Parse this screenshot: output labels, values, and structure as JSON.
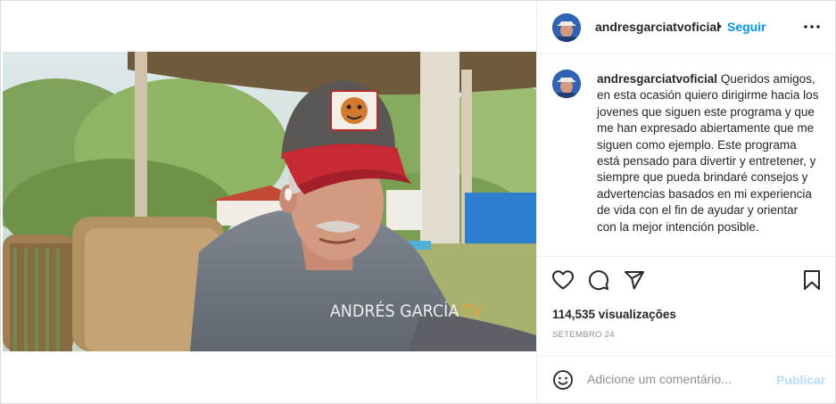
{
  "post": {
    "username": "andresgarciatvoficial",
    "separator": "•",
    "follow_label": "Seguir",
    "more_icon": "more-options-icon",
    "caption_text": "Queridos amigos, en esta ocasión quiero dirigirme hacia los jovenes que siguen este programa y que me han expresado abiertamente que me siguen como ejemplo. Este programa está pensado para divertir y entretener, y siempre que pueda brindaré consejos y advertencias basados en mi experiencia de vida con el fin de ayudar y orientar con la mejor intención posible.",
    "views": "114,535 visualizações",
    "date": "SETEMBRO 24"
  },
  "video": {
    "watermark": "ANDRÉS GARCÍA",
    "watermark_tv": "TV"
  },
  "actions": {
    "like_icon": "heart-icon",
    "comment_icon": "comment-icon",
    "share_icon": "share-icon",
    "save_icon": "bookmark-icon"
  },
  "comment_box": {
    "placeholder": "Adicione um comentário...",
    "publish_label": "Publicar"
  },
  "colors": {
    "link": "#0095f6",
    "publish_disabled": "#b3dbff",
    "secondary_text": "#8e8e8e",
    "tv_accent": "#e5a33a"
  }
}
